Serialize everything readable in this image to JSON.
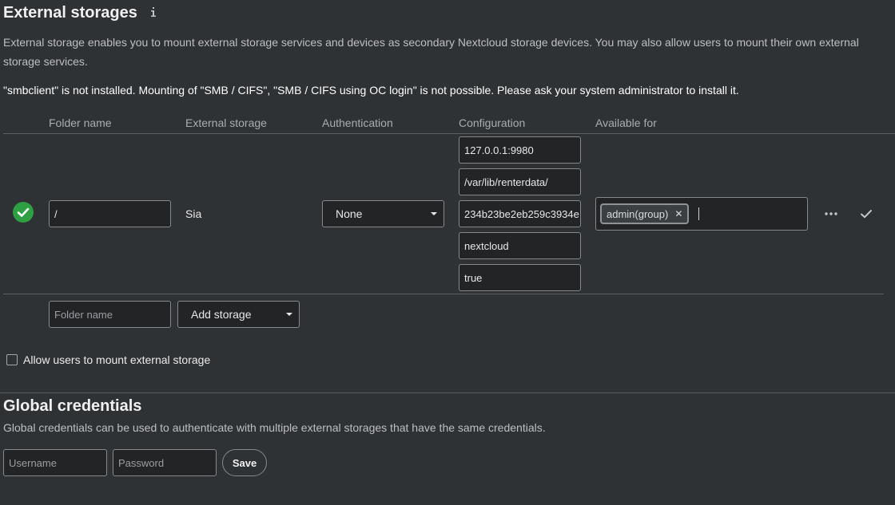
{
  "external_storages": {
    "title": "External storages",
    "info_icon": "info-icon",
    "description": "External storage enables you to mount external storage services and devices as secondary Nextcloud storage devices. You may also allow users to mount their own external storage services.",
    "warning": "\"smbclient\" is not installed. Mounting of \"SMB / CIFS\", \"SMB / CIFS using OC login\" is not possible. Please ask your system administrator to install it.",
    "columns": [
      "Folder name",
      "External storage",
      "Authentication",
      "Configuration",
      "Available for"
    ],
    "mount": {
      "status_icon": "check-circle-icon",
      "status_color": "#2ea043",
      "folder_name": "/",
      "backend": "Sia",
      "authentication": "None",
      "configuration": [
        "127.0.0.1:9980",
        "/var/lib/renterdata/",
        "234b23be2eb259c3934e",
        "nextcloud",
        "true"
      ],
      "available_for": [
        "admin(group)"
      ],
      "more_icon": "more-horizontal-icon",
      "save_icon": "check-icon"
    },
    "new_mount": {
      "folder_placeholder": "Folder name",
      "add_storage_label": "Add storage"
    },
    "allow_users_label": "Allow users to mount external storage"
  },
  "global_credentials": {
    "title": "Global credentials",
    "description": "Global credentials can be used to authenticate with multiple external storages that have the same credentials.",
    "username_placeholder": "Username",
    "password_placeholder": "Password",
    "save_label": "Save"
  }
}
